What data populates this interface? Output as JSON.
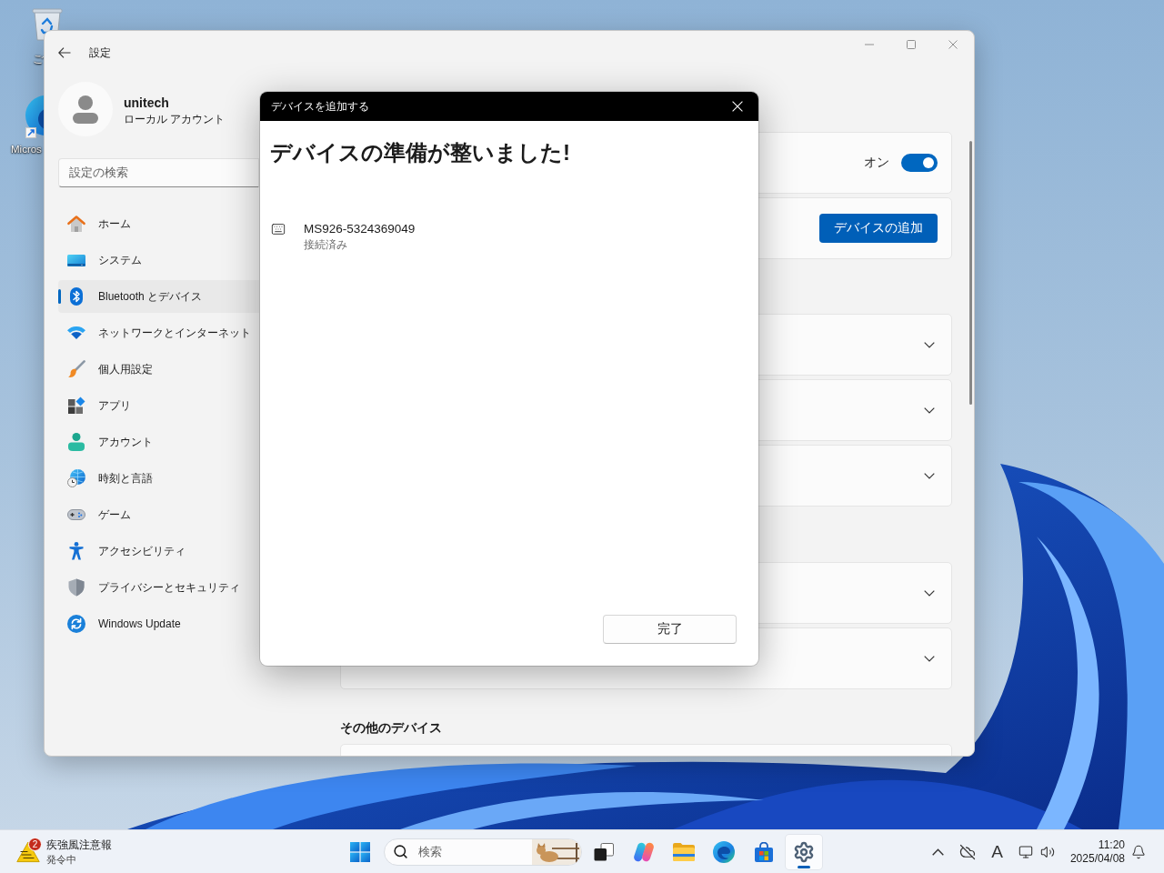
{
  "desktop_icons": [
    {
      "label": "ご"
    },
    {
      "label": "Micros"
    }
  ],
  "settings_window": {
    "title": "設定",
    "account": {
      "name": "unitech",
      "type": "ローカル アカウント"
    },
    "search": {
      "placeholder": "設定の検索"
    },
    "nav": [
      {
        "label": "ホーム",
        "selected": false
      },
      {
        "label": "システム",
        "selected": false
      },
      {
        "label": "Bluetooth とデバイス",
        "selected": true
      },
      {
        "label": "ネットワークとインターネット",
        "selected": false
      },
      {
        "label": "個人用設定",
        "selected": false
      },
      {
        "label": "アプリ",
        "selected": false
      },
      {
        "label": "アカウント",
        "selected": false
      },
      {
        "label": "時刻と言語",
        "selected": false
      },
      {
        "label": "ゲーム",
        "selected": false
      },
      {
        "label": "アクセシビリティ",
        "selected": false
      },
      {
        "label": "プライバシーとセキュリティ",
        "selected": false
      },
      {
        "label": "Windows Update",
        "selected": false
      }
    ],
    "toggle_card": {
      "state_label": "オン",
      "on": true
    },
    "add_device_button": "デバイスの追加",
    "expander_groups": [
      {
        "cards": [
          {
            "expanded": false
          },
          {
            "expanded": false
          },
          {
            "expanded": false
          }
        ]
      },
      {
        "cards": [
          {
            "expanded": false
          },
          {
            "expanded": false
          }
        ]
      }
    ],
    "other_devices": {
      "heading": "その他のデバイス"
    }
  },
  "dialog": {
    "title": "デバイスを追加する",
    "heading": "デバイスの準備が整いました!",
    "device": {
      "name": "MS926-5324369049",
      "status": "接続済み"
    },
    "done_button": "完了"
  },
  "taskbar": {
    "weather": {
      "alert_count": "2",
      "title": "疾強風注意報",
      "subtitle": "発令中"
    },
    "search": {
      "placeholder": "検索"
    },
    "apps": [
      {
        "selected": false
      },
      {
        "selected": false
      },
      {
        "selected": false
      },
      {
        "selected": false
      },
      {
        "selected": false
      },
      {
        "selected": true
      }
    ],
    "input_mode": "A",
    "clock": {
      "time": "11:20",
      "date": "2025/04/08"
    }
  }
}
